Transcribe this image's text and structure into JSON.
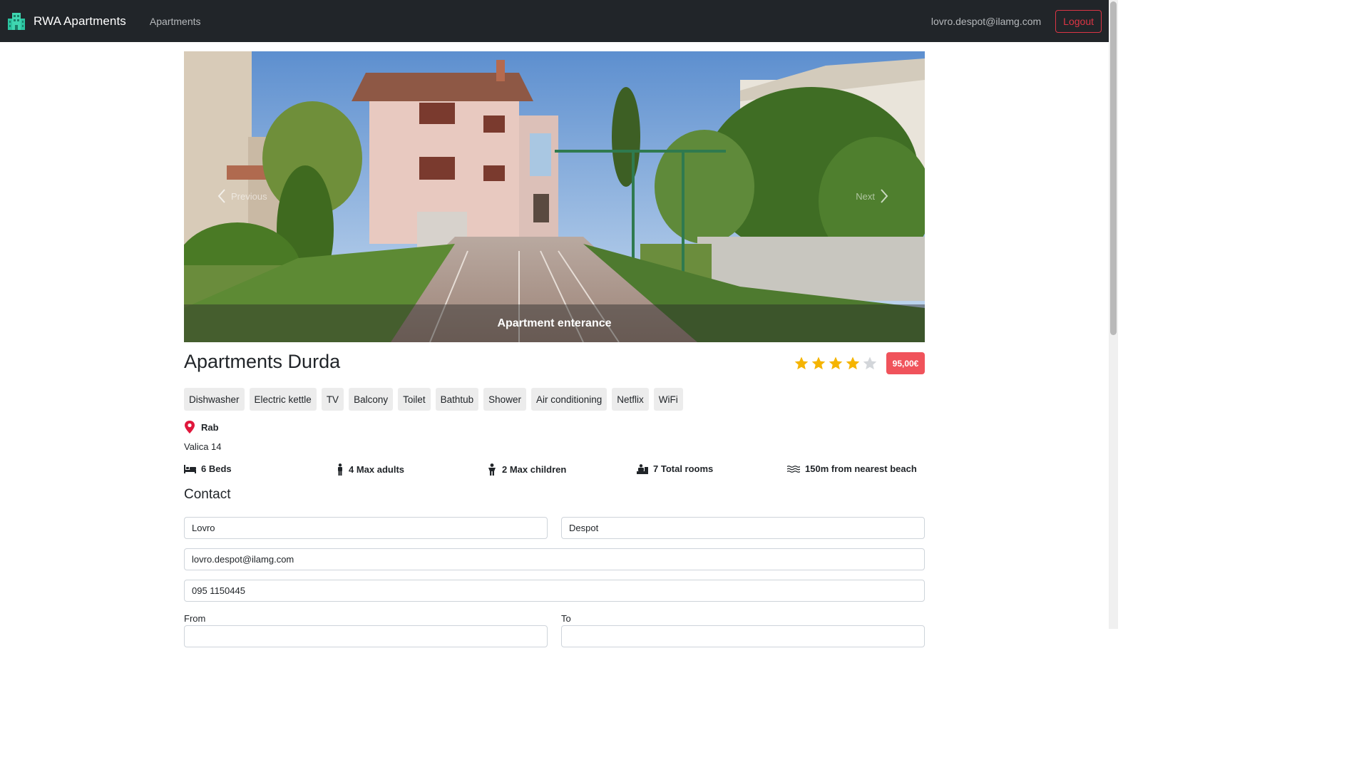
{
  "navbar": {
    "brand": "RWA Apartments",
    "brand_icon": "building-icon",
    "brand_color": "#2bc4a0",
    "nav_link": "Apartments",
    "user_email": "lovro.despot@ilamg.com",
    "logout_label": "Logout",
    "logout_color": "#dc3545"
  },
  "carousel": {
    "caption": "Apartment enterance",
    "prev_label": "Previous",
    "next_label": "Next"
  },
  "apartment": {
    "name": "Apartments Durda",
    "rating": 4,
    "rating_max": 5,
    "price": "95,00€",
    "price_color": "#f0535b",
    "star_color": "#f5b400",
    "amenities": [
      "Dishwasher",
      "Electric kettle",
      "TV",
      "Balcony",
      "Toilet",
      "Bathtub",
      "Shower",
      "Air conditioning",
      "Netflix",
      "WiFi"
    ],
    "city": "Rab",
    "address": "Valica 14",
    "features": {
      "beds": "6 Beds",
      "max_adults": "4 Max adults",
      "max_children": "2 Max children",
      "total_rooms": "7 Total rooms",
      "beach": "150m from nearest beach"
    }
  },
  "contact": {
    "heading": "Contact",
    "first_name": "Lovro",
    "last_name": "Despot",
    "email": "lovro.despot@ilamg.com",
    "phone": "095 1150445",
    "from_label": "From",
    "to_label": "To"
  }
}
